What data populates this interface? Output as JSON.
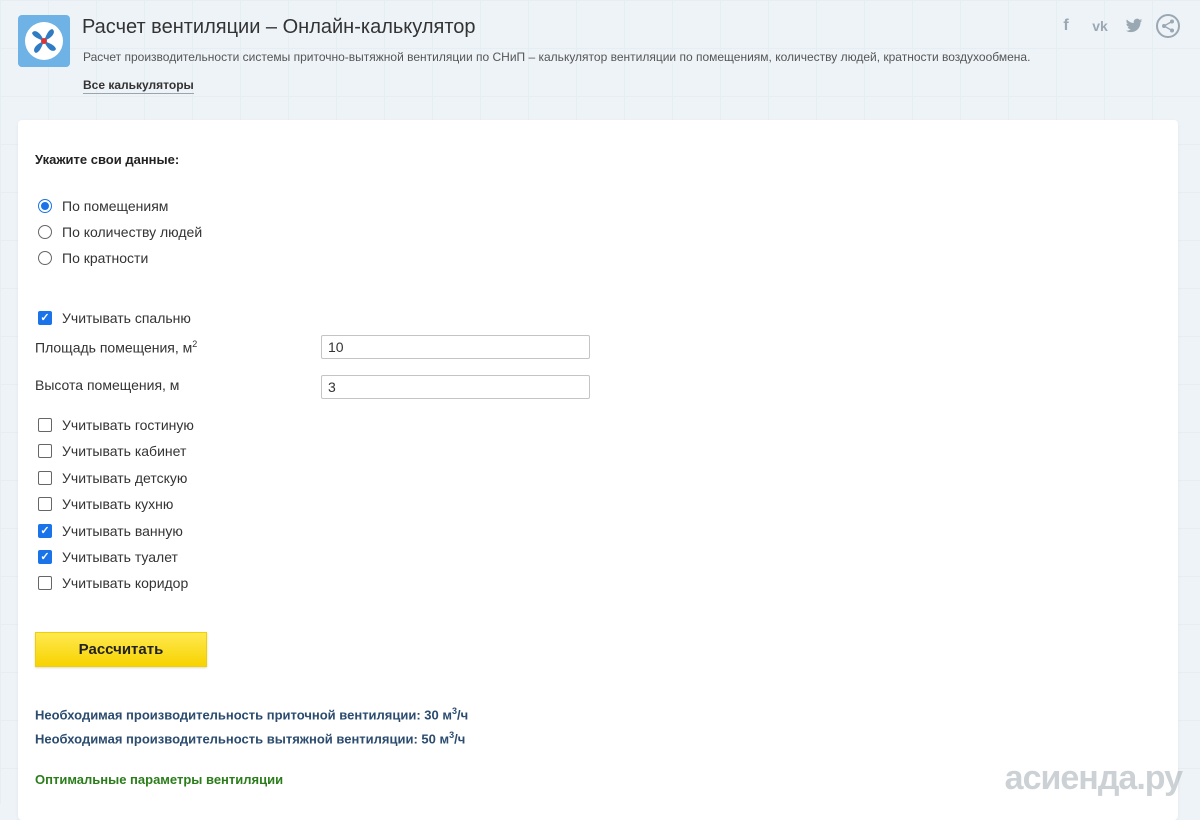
{
  "header": {
    "title": "Расчет вентиляции – Онлайн-калькулятор",
    "subtitle": "Расчет производительности системы приточно-вытяжной вентиляции по СНиП – калькулятор вентиляции по помещениям, количеству людей, кратности воздухообмена.",
    "all_calculators": "Все калькуляторы"
  },
  "social": {
    "facebook": "f",
    "vk": "vk",
    "twitter": "🐦",
    "share": "⋖"
  },
  "form": {
    "prompt": "Укажите свои данные:",
    "radios": [
      {
        "label": "По помещениям",
        "checked": true
      },
      {
        "label": "По количеству людей",
        "checked": false
      },
      {
        "label": "По кратности",
        "checked": false
      }
    ],
    "bedroom": {
      "label": "Учитывать спальню",
      "checked": true
    },
    "area": {
      "label": "Площадь помещения, м",
      "sup": "2",
      "value": "10"
    },
    "height": {
      "label": "Высота помещения, м",
      "value": "3"
    },
    "rooms": [
      {
        "label": "Учитывать гостиную",
        "checked": false
      },
      {
        "label": "Учитывать кабинет",
        "checked": false
      },
      {
        "label": "Учитывать детскую",
        "checked": false
      },
      {
        "label": "Учитывать кухню",
        "checked": false
      },
      {
        "label": "Учитывать ванную",
        "checked": true
      },
      {
        "label": "Учитывать туалет",
        "checked": true
      },
      {
        "label": "Учитывать коридор",
        "checked": false
      }
    ],
    "calc_button": "Рассчитать"
  },
  "results": {
    "supply": {
      "text": "Необходимая производительность приточной вентиляции: 30 м",
      "sup": "3",
      "unit": "/ч"
    },
    "exhaust": {
      "text": "Необходимая производительность вытяжной вентиляции: 50 м",
      "sup": "3",
      "unit": "/ч"
    },
    "optimal": "Оптимальные параметры вентиляции"
  },
  "watermark": "асиенда.ру"
}
